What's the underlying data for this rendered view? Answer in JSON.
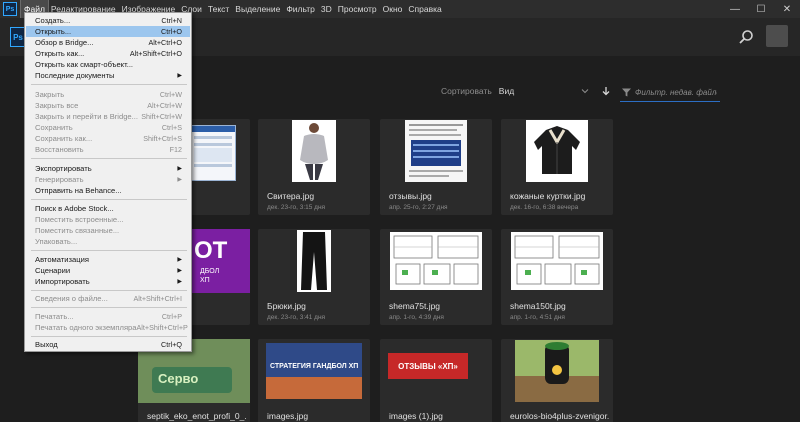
{
  "menubar": {
    "items": [
      "Файл",
      "Редактирование",
      "Изображение",
      "Слои",
      "Текст",
      "Выделение",
      "Фильтр",
      "3D",
      "Просмотр",
      "Окно",
      "Справка"
    ],
    "ps_logo": "Ps",
    "controls": {
      "minimize": "—",
      "maximize": "☐",
      "close": "✕"
    }
  },
  "file_menu": {
    "items": [
      {
        "label": "Создать...",
        "shortcut": "Ctrl+N"
      },
      {
        "label": "Открыть...",
        "shortcut": "Ctrl+O"
      },
      {
        "label": "Обзор в Bridge...",
        "shortcut": "Alt+Ctrl+O"
      },
      {
        "label": "Открыть как...",
        "shortcut": "Alt+Shift+Ctrl+O"
      },
      {
        "label": "Открыть как смарт-объект...",
        "shortcut": ""
      },
      {
        "label": "Последние документы",
        "shortcut": ""
      },
      {
        "label": "Закрыть",
        "shortcut": "Ctrl+W"
      },
      {
        "label": "Закрыть все",
        "shortcut": "Alt+Ctrl+W"
      },
      {
        "label": "Закрыть и перейти в Bridge...",
        "shortcut": "Shift+Ctrl+W"
      },
      {
        "label": "Сохранить",
        "shortcut": "Ctrl+S"
      },
      {
        "label": "Сохранить как...",
        "shortcut": "Shift+Ctrl+S"
      },
      {
        "label": "Восстановить",
        "shortcut": "F12"
      },
      {
        "label": "Экспортировать",
        "shortcut": ""
      },
      {
        "label": "Генерировать",
        "shortcut": ""
      },
      {
        "label": "Отправить на Behance...",
        "shortcut": ""
      },
      {
        "label": "Поиск в Adobe Stock...",
        "shortcut": ""
      },
      {
        "label": "Поместить встроенные...",
        "shortcut": ""
      },
      {
        "label": "Поместить связанные...",
        "shortcut": ""
      },
      {
        "label": "Упаковать...",
        "shortcut": ""
      },
      {
        "label": "Автоматизация",
        "shortcut": ""
      },
      {
        "label": "Сценарии",
        "shortcut": ""
      },
      {
        "label": "Импортировать",
        "shortcut": ""
      },
      {
        "label": "Сведения о файле...",
        "shortcut": "Alt+Shift+Ctrl+I"
      },
      {
        "label": "Печатать...",
        "shortcut": "Ctrl+P"
      },
      {
        "label": "Печатать одного экземпляра",
        "shortcut": "Alt+Shift+Ctrl+P"
      },
      {
        "label": "Выход",
        "shortcut": "Ctrl+Q"
      }
    ]
  },
  "toolbar": {
    "sort_label": "Сортировать",
    "sort_value": "Вид",
    "filter_placeholder": "Фильтр. недав. файлов"
  },
  "files": [
    {
      "name": "",
      "date": ""
    },
    {
      "name": "Свитера.jpg",
      "date": "дек. 23-го, 3:15 дня"
    },
    {
      "name": "отзывы.jpg",
      "date": "апр. 25-го, 2:27 дня"
    },
    {
      "name": "кожаные куртки.jpg",
      "date": "дек. 16-го, 6:38 вечера"
    },
    {
      "name": "",
      "date": ""
    },
    {
      "name": "Брюки.jpg",
      "date": "дек. 23-го, 3:41 дня"
    },
    {
      "name": "shema75t.jpg",
      "date": "апр. 1-го, 4:39 дня"
    },
    {
      "name": "shema150t.jpg",
      "date": "апр. 1-го, 4:51 дня"
    },
    {
      "name": "septik_eko_enot_profi_0_...",
      "date": ""
    },
    {
      "name": "images.jpg",
      "date": ""
    },
    {
      "name": "images (1).jpg",
      "date": ""
    },
    {
      "name": "eurolos-bio4plus-zvenigor...",
      "date": ""
    }
  ],
  "thumb_texts": {
    "ot": "OT",
    "sub": "ДБОЛ\nХП",
    "servo": "Серво",
    "handball": "СТРАТЕГИЯ ГАНДБОЛ ХП",
    "otzyvy": "ОТЗЫВЫ «ХП»"
  }
}
